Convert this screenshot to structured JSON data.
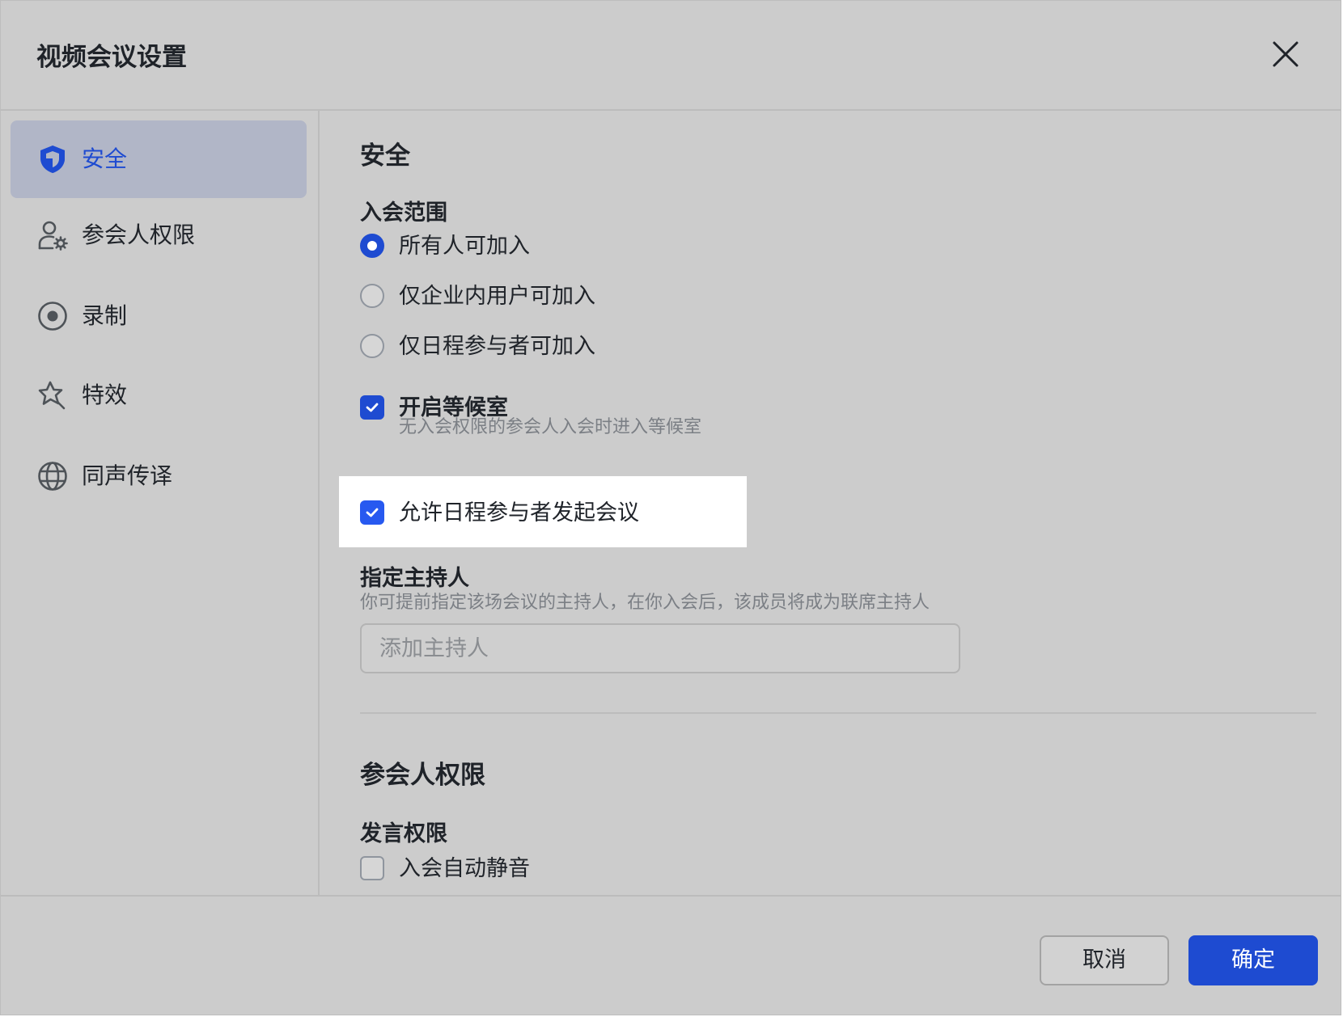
{
  "dialog": {
    "title": "视频会议设置"
  },
  "sidebar": {
    "items": [
      {
        "label": "安全",
        "icon": "shield-icon"
      },
      {
        "label": "参会人权限",
        "icon": "user-settings-icon"
      },
      {
        "label": "录制",
        "icon": "record-icon"
      },
      {
        "label": "特效",
        "icon": "sparkle-star-icon"
      },
      {
        "label": "同声传译",
        "icon": "globe-icon"
      }
    ],
    "active_index": 0
  },
  "security": {
    "title": "安全",
    "join_scope": {
      "label": "入会范围",
      "options": [
        "所有人可加入",
        "仅企业内用户可加入",
        "仅日程参与者可加入"
      ],
      "selected_index": 0
    },
    "waiting_room": {
      "label": "开启等候室",
      "checked": true,
      "hint": "无入会权限的参会人入会时进入等候室"
    },
    "allow_attendee_start": {
      "label": "允许日程参与者发起会议",
      "checked": true
    },
    "host": {
      "label": "指定主持人",
      "hint": "你可提前指定该场会议的主持人，在你入会后，该成员将成为联席主持人",
      "placeholder": "添加主持人"
    }
  },
  "participant_permissions": {
    "title": "参会人权限",
    "speak": {
      "label": "发言权限",
      "auto_mute": {
        "label": "入会自动静音",
        "checked": false
      }
    }
  },
  "footer": {
    "cancel_label": "取消",
    "ok_label": "确定"
  },
  "colors": {
    "accent": "#1e4bd1",
    "dialog_bg": "#cccccc",
    "active_nav_bg": "#b1b6c7"
  }
}
